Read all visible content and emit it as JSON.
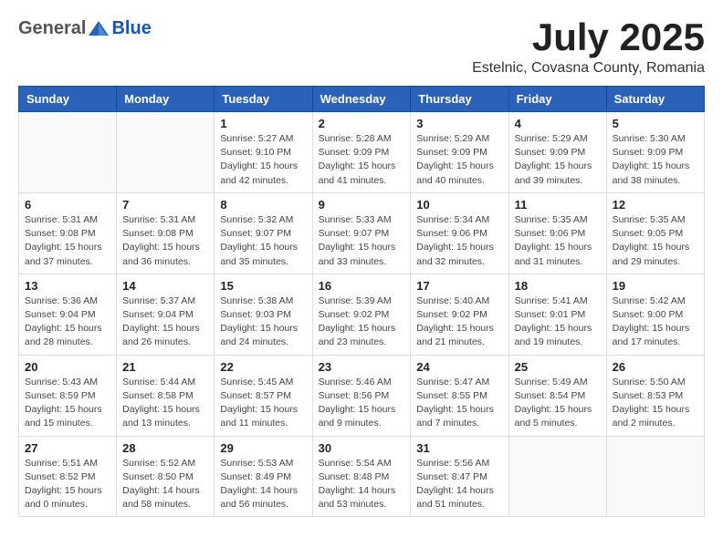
{
  "logo": {
    "general": "General",
    "blue": "Blue"
  },
  "title": "July 2025",
  "subtitle": "Estelnic, Covasna County, Romania",
  "days_of_week": [
    "Sunday",
    "Monday",
    "Tuesday",
    "Wednesday",
    "Thursday",
    "Friday",
    "Saturday"
  ],
  "weeks": [
    [
      {
        "day": "",
        "info": ""
      },
      {
        "day": "",
        "info": ""
      },
      {
        "day": "1",
        "info": "Sunrise: 5:27 AM\nSunset: 9:10 PM\nDaylight: 15 hours\nand 42 minutes."
      },
      {
        "day": "2",
        "info": "Sunrise: 5:28 AM\nSunset: 9:09 PM\nDaylight: 15 hours\nand 41 minutes."
      },
      {
        "day": "3",
        "info": "Sunrise: 5:29 AM\nSunset: 9:09 PM\nDaylight: 15 hours\nand 40 minutes."
      },
      {
        "day": "4",
        "info": "Sunrise: 5:29 AM\nSunset: 9:09 PM\nDaylight: 15 hours\nand 39 minutes."
      },
      {
        "day": "5",
        "info": "Sunrise: 5:30 AM\nSunset: 9:09 PM\nDaylight: 15 hours\nand 38 minutes."
      }
    ],
    [
      {
        "day": "6",
        "info": "Sunrise: 5:31 AM\nSunset: 9:08 PM\nDaylight: 15 hours\nand 37 minutes."
      },
      {
        "day": "7",
        "info": "Sunrise: 5:31 AM\nSunset: 9:08 PM\nDaylight: 15 hours\nand 36 minutes."
      },
      {
        "day": "8",
        "info": "Sunrise: 5:32 AM\nSunset: 9:07 PM\nDaylight: 15 hours\nand 35 minutes."
      },
      {
        "day": "9",
        "info": "Sunrise: 5:33 AM\nSunset: 9:07 PM\nDaylight: 15 hours\nand 33 minutes."
      },
      {
        "day": "10",
        "info": "Sunrise: 5:34 AM\nSunset: 9:06 PM\nDaylight: 15 hours\nand 32 minutes."
      },
      {
        "day": "11",
        "info": "Sunrise: 5:35 AM\nSunset: 9:06 PM\nDaylight: 15 hours\nand 31 minutes."
      },
      {
        "day": "12",
        "info": "Sunrise: 5:35 AM\nSunset: 9:05 PM\nDaylight: 15 hours\nand 29 minutes."
      }
    ],
    [
      {
        "day": "13",
        "info": "Sunrise: 5:36 AM\nSunset: 9:04 PM\nDaylight: 15 hours\nand 28 minutes."
      },
      {
        "day": "14",
        "info": "Sunrise: 5:37 AM\nSunset: 9:04 PM\nDaylight: 15 hours\nand 26 minutes."
      },
      {
        "day": "15",
        "info": "Sunrise: 5:38 AM\nSunset: 9:03 PM\nDaylight: 15 hours\nand 24 minutes."
      },
      {
        "day": "16",
        "info": "Sunrise: 5:39 AM\nSunset: 9:02 PM\nDaylight: 15 hours\nand 23 minutes."
      },
      {
        "day": "17",
        "info": "Sunrise: 5:40 AM\nSunset: 9:02 PM\nDaylight: 15 hours\nand 21 minutes."
      },
      {
        "day": "18",
        "info": "Sunrise: 5:41 AM\nSunset: 9:01 PM\nDaylight: 15 hours\nand 19 minutes."
      },
      {
        "day": "19",
        "info": "Sunrise: 5:42 AM\nSunset: 9:00 PM\nDaylight: 15 hours\nand 17 minutes."
      }
    ],
    [
      {
        "day": "20",
        "info": "Sunrise: 5:43 AM\nSunset: 8:59 PM\nDaylight: 15 hours\nand 15 minutes."
      },
      {
        "day": "21",
        "info": "Sunrise: 5:44 AM\nSunset: 8:58 PM\nDaylight: 15 hours\nand 13 minutes."
      },
      {
        "day": "22",
        "info": "Sunrise: 5:45 AM\nSunset: 8:57 PM\nDaylight: 15 hours\nand 11 minutes."
      },
      {
        "day": "23",
        "info": "Sunrise: 5:46 AM\nSunset: 8:56 PM\nDaylight: 15 hours\nand 9 minutes."
      },
      {
        "day": "24",
        "info": "Sunrise: 5:47 AM\nSunset: 8:55 PM\nDaylight: 15 hours\nand 7 minutes."
      },
      {
        "day": "25",
        "info": "Sunrise: 5:49 AM\nSunset: 8:54 PM\nDaylight: 15 hours\nand 5 minutes."
      },
      {
        "day": "26",
        "info": "Sunrise: 5:50 AM\nSunset: 8:53 PM\nDaylight: 15 hours\nand 2 minutes."
      }
    ],
    [
      {
        "day": "27",
        "info": "Sunrise: 5:51 AM\nSunset: 8:52 PM\nDaylight: 15 hours\nand 0 minutes."
      },
      {
        "day": "28",
        "info": "Sunrise: 5:52 AM\nSunset: 8:50 PM\nDaylight: 14 hours\nand 58 minutes."
      },
      {
        "day": "29",
        "info": "Sunrise: 5:53 AM\nSunset: 8:49 PM\nDaylight: 14 hours\nand 56 minutes."
      },
      {
        "day": "30",
        "info": "Sunrise: 5:54 AM\nSunset: 8:48 PM\nDaylight: 14 hours\nand 53 minutes."
      },
      {
        "day": "31",
        "info": "Sunrise: 5:56 AM\nSunset: 8:47 PM\nDaylight: 14 hours\nand 51 minutes."
      },
      {
        "day": "",
        "info": ""
      },
      {
        "day": "",
        "info": ""
      }
    ]
  ]
}
